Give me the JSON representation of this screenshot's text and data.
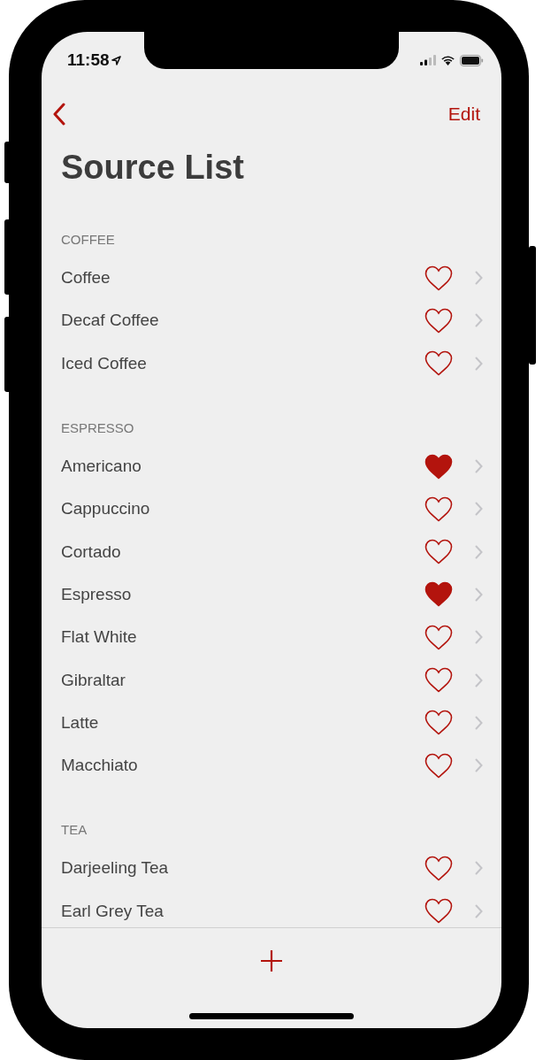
{
  "status_bar": {
    "time": "11:58"
  },
  "nav": {
    "edit": "Edit"
  },
  "title": "Source List",
  "sections": [
    {
      "title": "COFFEE",
      "items": [
        {
          "name": "Coffee",
          "favorite": false
        },
        {
          "name": "Decaf Coffee",
          "favorite": false
        },
        {
          "name": "Iced Coffee",
          "favorite": false
        }
      ]
    },
    {
      "title": "ESPRESSO",
      "items": [
        {
          "name": "Americano",
          "favorite": true
        },
        {
          "name": "Cappuccino",
          "favorite": false
        },
        {
          "name": "Cortado",
          "favorite": false
        },
        {
          "name": "Espresso",
          "favorite": true
        },
        {
          "name": "Flat White",
          "favorite": false
        },
        {
          "name": "Gibraltar",
          "favorite": false
        },
        {
          "name": "Latte",
          "favorite": false
        },
        {
          "name": "Macchiato",
          "favorite": false
        }
      ]
    },
    {
      "title": "TEA",
      "items": [
        {
          "name": "Darjeeling Tea",
          "favorite": false
        },
        {
          "name": "Earl Grey Tea",
          "favorite": false
        }
      ]
    }
  ]
}
